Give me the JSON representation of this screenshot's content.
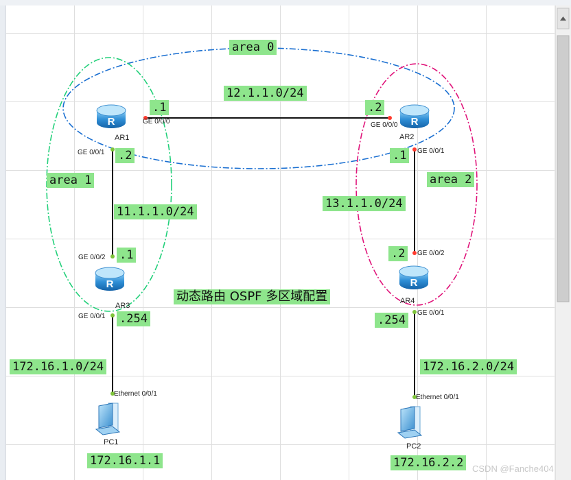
{
  "title": "动态路由 OSPF 多区域配置",
  "areas": {
    "area0": "area 0",
    "area1": "area 1",
    "area2": "area 2"
  },
  "networks": {
    "n12": "12.1.1.0/24",
    "n11": "11.1.1.0/24",
    "n13": "13.1.1.0/24",
    "lan1": "172.16.1.0/24",
    "lan2": "172.16.2.0/24"
  },
  "devices": {
    "ar1": "AR1",
    "ar2": "AR2",
    "ar3": "AR3",
    "ar4": "AR4",
    "pc1": "PC1",
    "pc2": "PC2"
  },
  "host_ips": {
    "pc1": "172.16.1.1",
    "pc2": "172.16.2.2"
  },
  "interfaces": {
    "ar1_g000": {
      "port": "GE 0/0/0",
      "ip": ".1"
    },
    "ar1_g001": {
      "port": "GE 0/0/1",
      "ip": ".2"
    },
    "ar2_g000": {
      "port": "GE 0/0/0",
      "ip": ".2"
    },
    "ar2_g001": {
      "port": "GE 0/0/1",
      "ip": ".1"
    },
    "ar3_g002": {
      "port": "GE 0/0/2",
      "ip": ".1"
    },
    "ar3_g001": {
      "port": "GE 0/0/1",
      "ip": ".254"
    },
    "ar4_g002": {
      "port": "GE 0/0/2",
      "ip": ".2"
    },
    "ar4_g001": {
      "port": "GE 0/0/1",
      "ip": ".254"
    },
    "pc1_eth": {
      "port": "Ethernet 0/0/1"
    },
    "pc2_eth": {
      "port": "Ethernet 0/0/1"
    }
  },
  "watermark": "CSDN @Fanche404",
  "colors": {
    "label_bg": "#8ee58c",
    "area0": "#1a6fd1",
    "area1": "#22d07a",
    "area2": "#e0147a",
    "link": "#111111",
    "port_down": "#ff3b2f",
    "port_up": "#7ec43a",
    "router_body": "#2f8fd6"
  }
}
